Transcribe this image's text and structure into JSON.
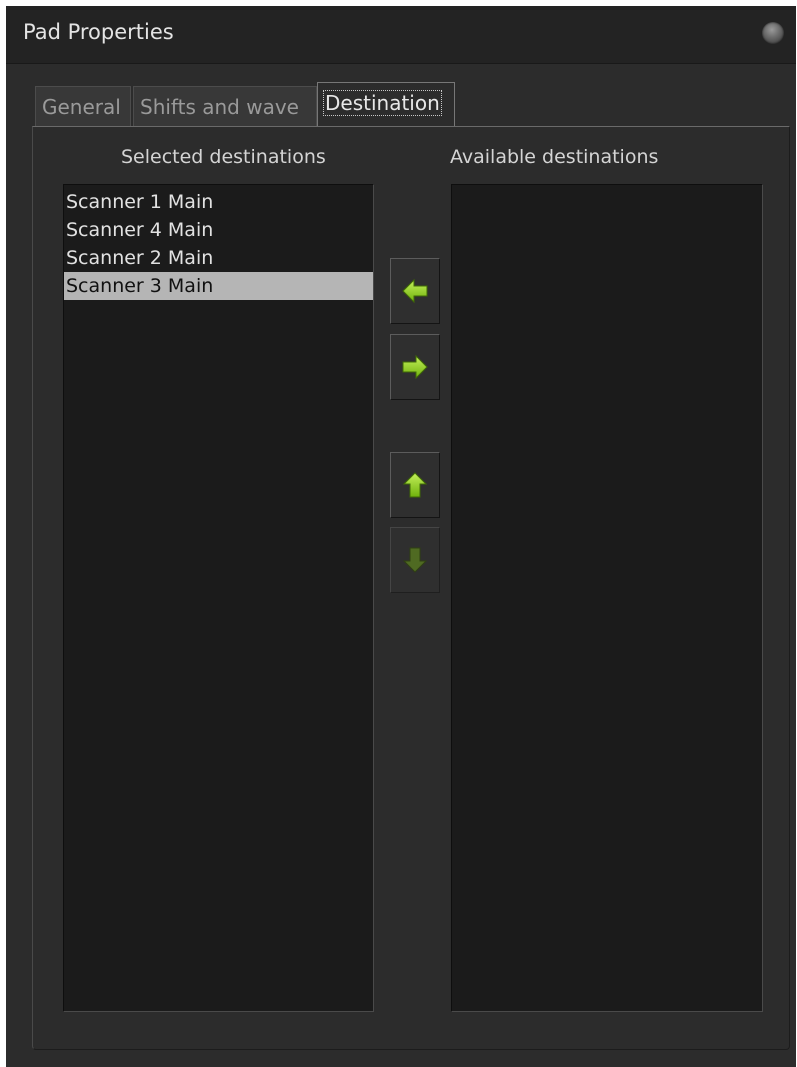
{
  "window": {
    "title": "Pad Properties"
  },
  "tabs": [
    {
      "label": "General",
      "active": false
    },
    {
      "label": "Shifts and wave",
      "active": false
    },
    {
      "label": "Destination",
      "active": true
    }
  ],
  "selected_destinations": {
    "label": "Selected destinations",
    "items": [
      "Scanner 1 Main",
      "Scanner 4 Main",
      "Scanner 2 Main",
      "Scanner 3 Main"
    ],
    "selected_item": "Scanner 3 Main"
  },
  "available_destinations": {
    "label": "Available destinations",
    "items": []
  },
  "buttons": {
    "add": {
      "icon": "arrow-left-icon",
      "enabled": true
    },
    "remove": {
      "icon": "arrow-right-icon",
      "enabled": true
    },
    "move_up": {
      "icon": "arrow-up-icon",
      "enabled": true
    },
    "move_down": {
      "icon": "arrow-down-icon",
      "enabled": false
    }
  },
  "colors": {
    "background": "#2c2c2c",
    "titlebar": "#232323",
    "listbox": "#1b1b1b",
    "selection": "#b5b5b5",
    "arrow_enabled": "#8fd11d",
    "arrow_disabled": "#4f6a22"
  }
}
